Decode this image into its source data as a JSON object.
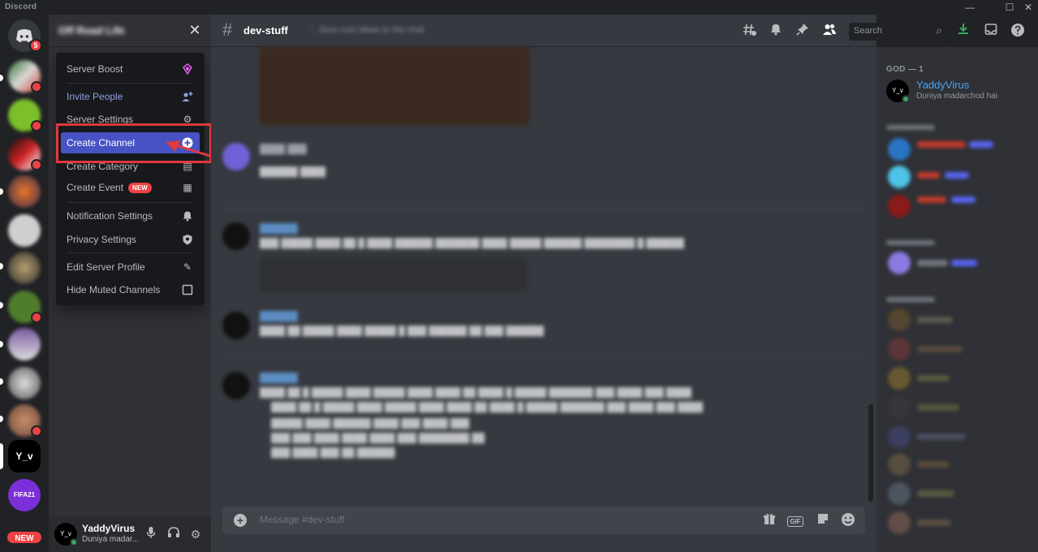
{
  "window": {
    "title": "Discord",
    "minimize": "—",
    "maximize": "☐",
    "close": "✕"
  },
  "rail": {
    "home_badge": "5",
    "yv_server": "Y_v",
    "fifa_server": "FIFA21",
    "new_badge": "NEW"
  },
  "sidebar": {
    "server_name": "Off Road Life",
    "close_icon": "✕"
  },
  "menu": {
    "items": [
      {
        "label": "Server Boost",
        "icon": "◆"
      },
      {
        "label": "Invite People",
        "icon": "👤"
      },
      {
        "label": "Server Settings",
        "icon": "⚙"
      },
      {
        "label": "Create Channel",
        "icon": "+"
      },
      {
        "label": "Create Category",
        "icon": "▤"
      },
      {
        "label": "Create Event",
        "icon": "▦",
        "tag": "NEW"
      },
      {
        "label": "Notification Settings",
        "icon": "🔔"
      },
      {
        "label": "Privacy Settings",
        "icon": "⛨"
      },
      {
        "label": "Edit Server Profile",
        "icon": "✎"
      },
      {
        "label": "Hide Muted Channels",
        "icon": "☐"
      }
    ]
  },
  "header": {
    "hash": "#",
    "channel": "dev-stuff",
    "topic": "Give cool ideas to the chat",
    "search_placeholder": "Search",
    "search_icon": "⌕"
  },
  "composer": {
    "plus": "+",
    "placeholder": "Message #dev-stuff",
    "gif": "GIF"
  },
  "user": {
    "avatar": "Y_v",
    "name": "YaddyVirus",
    "status": "Duniya madar..."
  },
  "members": {
    "role": "GOD — 1",
    "avatar": "Y_v",
    "name": "YaddyVirus",
    "status": "Duniya madarchod hai"
  },
  "colors": {
    "accent": "#4752c4",
    "highlight": "#e0393e",
    "link": "#4ba3f2"
  }
}
